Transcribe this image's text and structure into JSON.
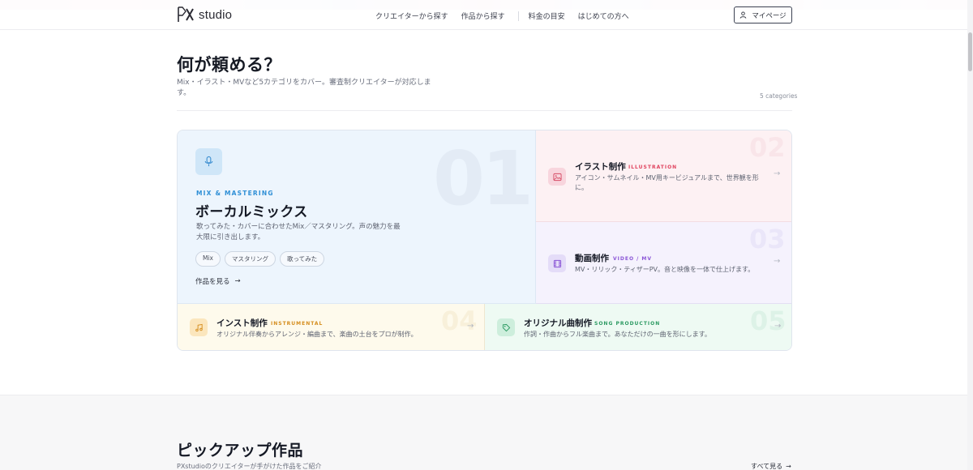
{
  "header": {
    "logo_text": "studio",
    "nav": [
      "クリエイターから探す",
      "作品から探す",
      "料金の目安",
      "はじめての方へ"
    ],
    "mypage_label": "マイページ"
  },
  "section": {
    "title": "何が頼める？",
    "description": "Mix・イラスト・MVなど5カテゴリをカバー。審査制クリエイターが対応します。",
    "count": "5 categories"
  },
  "categories": [
    {
      "number": "01",
      "kicker": "MIX & MASTERING",
      "title": "ボーカルミックス",
      "description": "歌ってみた・カバーに合わせたMix／マスタリング。声の魅力を最大限に引き出します。",
      "tags": [
        "Mix",
        "マスタリング",
        "歌ってみた"
      ],
      "more_label": "作品を見る",
      "icon": "microphone-icon",
      "accent": "#2f8fd6"
    },
    {
      "number": "02",
      "title": "イラスト制作",
      "kicker": "ILLUSTRATION",
      "description": "アイコン・サムネイル・MV用キービジュアルまで、世界観を形に。",
      "icon": "image-icon",
      "accent": "#e0445f"
    },
    {
      "number": "03",
      "title": "動画制作",
      "kicker": "VIDEO / MV",
      "description": "MV・リリック・ティザーPV。音と映像を一体で仕上げます。",
      "icon": "film-icon",
      "accent": "#8a55d6"
    },
    {
      "number": "04",
      "title": "インスト制作",
      "kicker": "INSTRUMENTAL",
      "description": "オリジナル伴奏からアレンジ・編曲まで、楽曲の土台をプロが制作。",
      "icon": "music-note-icon",
      "accent": "#d58d1d"
    },
    {
      "number": "05",
      "title": "オリジナル曲制作",
      "kicker": "SONG PRODUCTION",
      "description": "作詞・作曲からフル楽曲まで。あなただけの一曲を形にします。",
      "icon": "tag-icon",
      "accent": "#2c9a62"
    }
  ],
  "pickup": {
    "title": "ピックアップ作品",
    "description": "PXstudioのクリエイターが手がけた作品をご紹介",
    "see_all_label": "すべて見る"
  }
}
